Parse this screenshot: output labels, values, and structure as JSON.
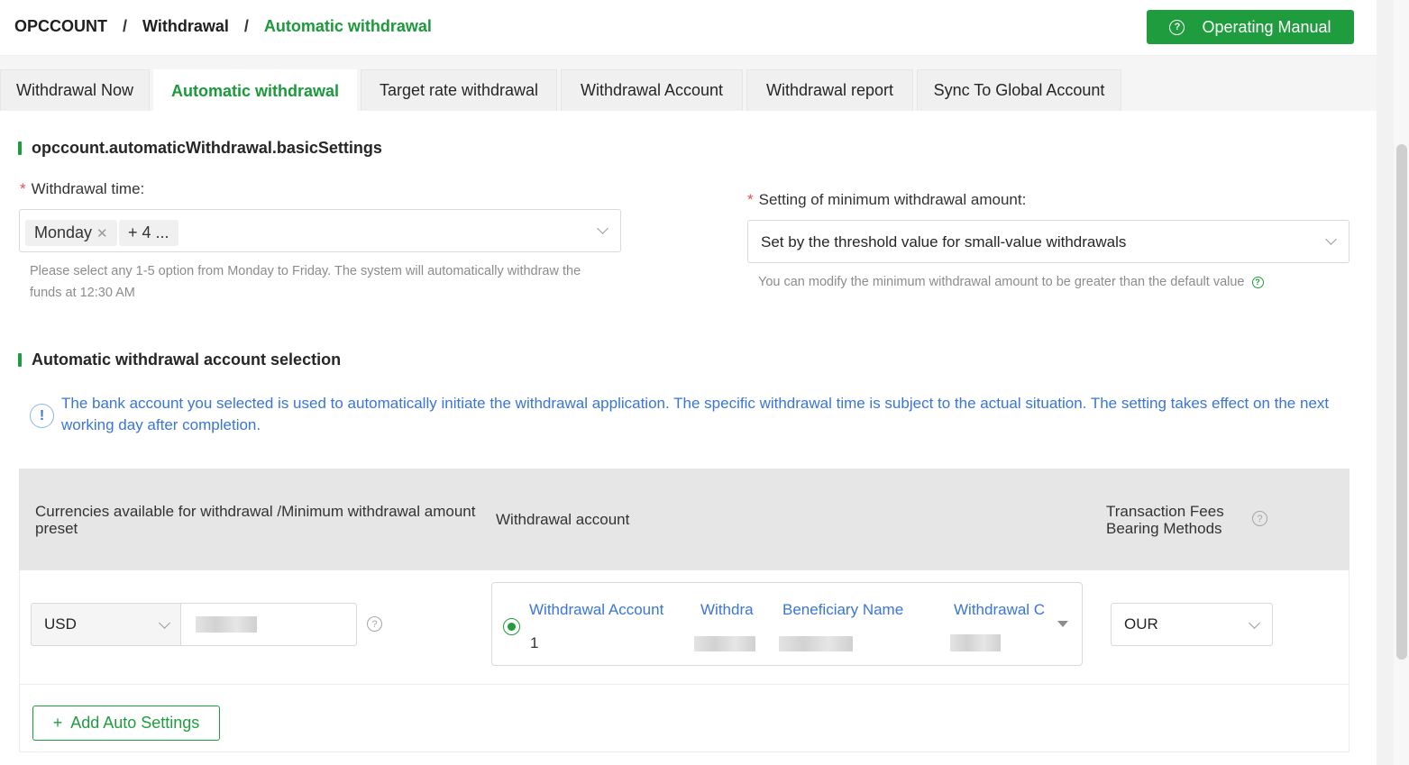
{
  "breadcrumb": {
    "items": [
      "OPCCOUNT",
      "Withdrawal",
      "Automatic withdrawal"
    ],
    "separator": "/"
  },
  "header": {
    "manual_label": "Operating Manual"
  },
  "tabs": [
    {
      "label": "Withdrawal Now",
      "active": false
    },
    {
      "label": "Automatic withdrawal",
      "active": true
    },
    {
      "label": "Target rate withdrawal",
      "active": false
    },
    {
      "label": "Withdrawal Account",
      "active": false
    },
    {
      "label": "Withdrawal report",
      "active": false
    },
    {
      "label": "Sync To Global Account",
      "active": false
    }
  ],
  "basic": {
    "title": "opccount.automaticWithdrawal.basicSettings",
    "time_label": "Withdrawal time:",
    "time_tags": [
      "Monday",
      "+ 4 ..."
    ],
    "time_help": "Please select any 1-5 option from Monday to Friday. The system will automatically withdraw the funds at 12:30 AM",
    "min_label": "Setting of minimum withdrawal amount:",
    "min_value": "Set by the threshold value for small-value withdrawals",
    "min_help": "You can modify the minimum withdrawal amount to be greater than the default value"
  },
  "account_section": {
    "title": "Automatic withdrawal account selection",
    "info": "The bank account you selected is used to automatically initiate the withdrawal application. The specific withdrawal time is subject to the actual situation. The setting takes effect on the next working day after completion."
  },
  "table": {
    "col_currency": "Currencies available for withdrawal /Minimum withdrawal amount preset",
    "col_account": "Withdrawal account",
    "col_fees": "Transaction Fees Bearing Methods",
    "row": {
      "currency": "USD",
      "account_columns": [
        "Withdrawal Account",
        "Withdra",
        "Beneficiary Name",
        "Withdrawal C"
      ],
      "account_first_value": "1",
      "fee": "OUR"
    }
  },
  "add_button": {
    "plus": "+",
    "label": "Add Auto Settings"
  },
  "colors": {
    "brand_green": "#1f9d3e",
    "link_blue": "#3a75d8",
    "required_red": "#e84b4b"
  }
}
